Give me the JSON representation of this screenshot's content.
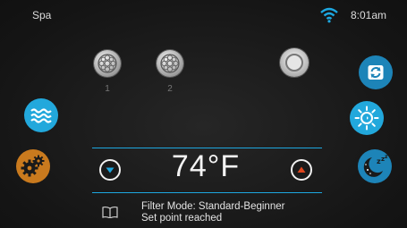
{
  "status_bar": {
    "title": "Spa",
    "time": "8:01am",
    "wifi_icon": "wifi-icon"
  },
  "jets": [
    {
      "label": "1",
      "icon": "jet-icon"
    },
    {
      "label": "2",
      "icon": "jet-icon"
    }
  ],
  "buttons": {
    "light": "light-icon",
    "waves": "waves-icon",
    "settings": "gears-icon",
    "cycle": "cycle-icon",
    "brightness": "sun-icon",
    "sleep": "sleep-icon"
  },
  "temperature": {
    "value": "74°F"
  },
  "status": {
    "filter_mode": "Filter Mode: Standard-Beginner",
    "message": "Set point reached",
    "book_icon": "book-icon"
  },
  "colors": {
    "accent_blue": "#22a8dc",
    "dark_blue": "#1d84b8",
    "orange": "#c97a1e",
    "arrow_up": "#e0461e",
    "arrow_down": "#1da7e0"
  }
}
